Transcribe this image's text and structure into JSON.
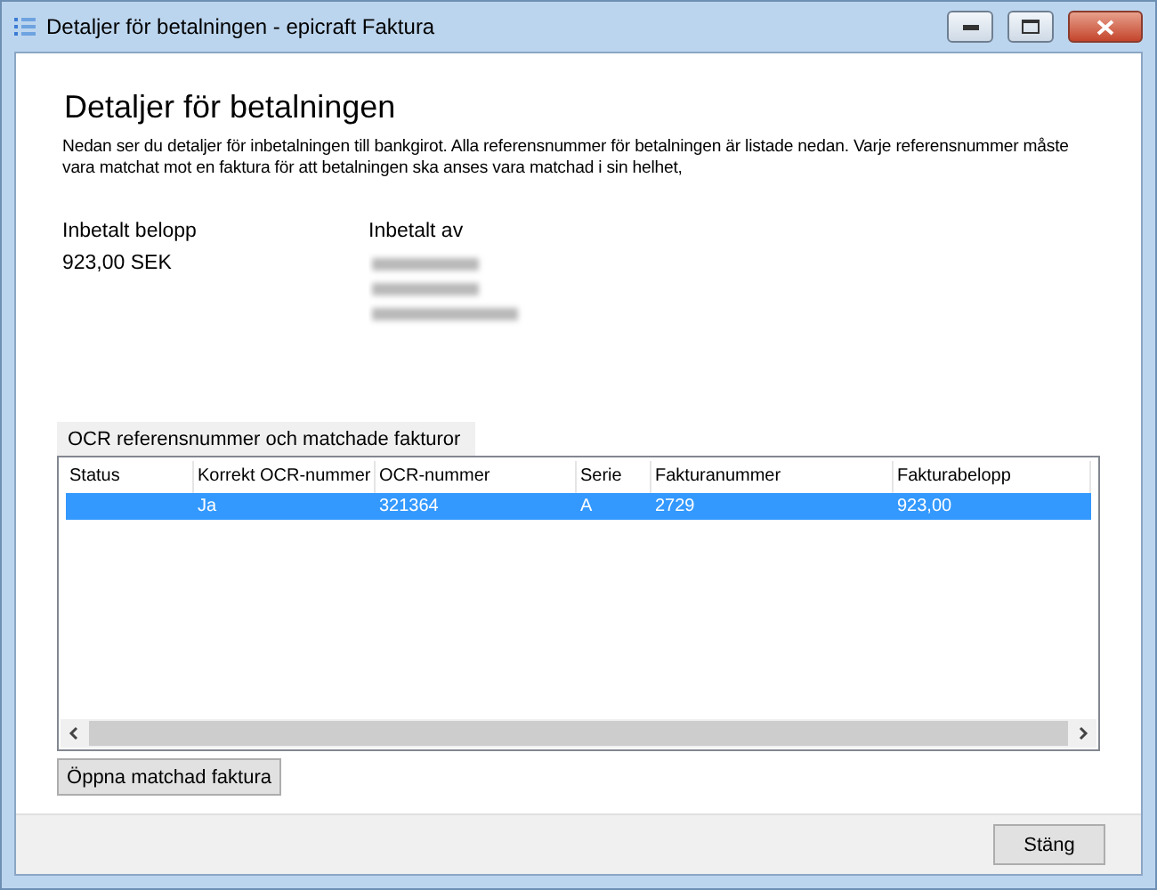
{
  "window": {
    "title": "Detaljer för betalningen - epicraft Faktura"
  },
  "heading": "Detaljer för betalningen",
  "description": "Nedan ser du detaljer för inbetalningen till bankgirot. Alla referensnummer för betalningen är listade nedan. Varje referensnummer måste vara matchat mot en faktura för att betalningen ska anses vara matchad i sin helhet,",
  "amount": {
    "label": "Inbetalt belopp",
    "value": "923,00 SEK"
  },
  "payer": {
    "label": "Inbetalt av"
  },
  "group": {
    "title": "OCR referensnummer och matchade fakturor"
  },
  "table": {
    "columns": [
      "Status",
      "Korrekt OCR-nummer",
      "OCR-nummer",
      "Serie",
      "Fakturanummer",
      "Fakturabelopp"
    ],
    "rows": [
      {
        "selected": true,
        "cells": [
          "",
          "Ja",
          "321364",
          "A",
          "2729",
          "923,00"
        ]
      }
    ]
  },
  "open_button": "Öppna matchad faktura",
  "close_button": "Stäng"
}
